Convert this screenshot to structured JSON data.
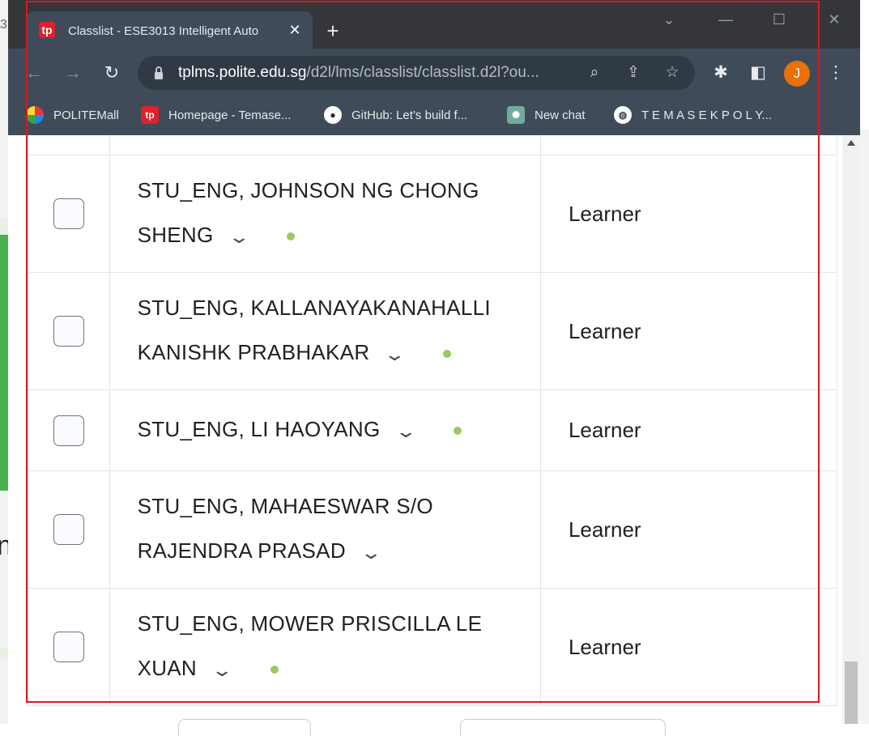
{
  "browser": {
    "tab_title": "Classlist - ESE3013 Intelligent Auto",
    "tab_favicon_text": "tp",
    "url_host": "tplms.polite.edu.sg",
    "url_path": "/d2l/lms/classlist/classlist.d2l?ou...",
    "avatar_letter": "J",
    "avatar_color": "#e8710a",
    "bookmarks": [
      {
        "label": "POLITEMall",
        "icon": "politemall-icon"
      },
      {
        "label": "Homepage - Temase...",
        "icon": "tp-icon"
      },
      {
        "label": "GitHub: Let’s build f...",
        "icon": "github-icon"
      },
      {
        "label": "New chat",
        "icon": "chatgpt-icon"
      },
      {
        "label": "T E M A S E K P O L Y...",
        "icon": "globe-icon"
      }
    ]
  },
  "background": {
    "left_fragment_top": "3",
    "left_fragment_mid": "n"
  },
  "classlist": {
    "rows": [
      {
        "name_line1": "STU_ENG, JOHNSON NG CHONG",
        "name_line2": "SHENG",
        "role": "Learner",
        "online": true
      },
      {
        "name_line1": "STU_ENG, KALLANAYAKANAHALLI",
        "name_line2": "KANISHK PRABHAKAR",
        "role": "Learner",
        "online": true
      },
      {
        "name_line1": "STU_ENG, LI HAOYANG",
        "name_line2": "",
        "role": "Learner",
        "online": true
      },
      {
        "name_line1": "STU_ENG, MAHAESWAR S/O",
        "name_line2": "RAJENDRA PRASAD",
        "role": "Learner",
        "online": false
      },
      {
        "name_line1": "STU_ENG, MOWER PRISCILLA LE",
        "name_line2": "XUAN",
        "role": "Learner",
        "online": true
      }
    ]
  },
  "colors": {
    "online_dot": "#9ac95f",
    "annotation_frame": "#e0171f",
    "chrome_toolbar": "#3f4b58"
  }
}
